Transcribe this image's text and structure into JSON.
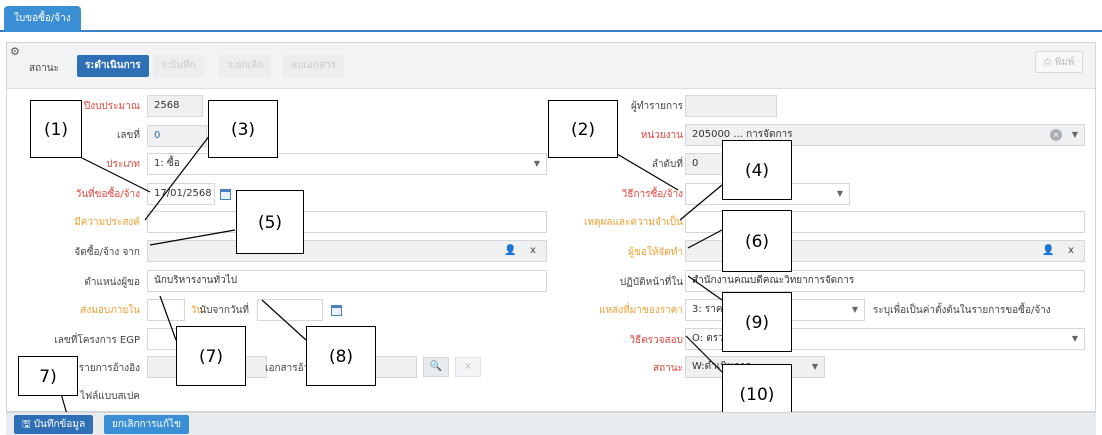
{
  "tab": {
    "label": "ใบขอซื้อ/จ้าง"
  },
  "toolbar": {
    "status_label": "สถานะ",
    "status_steps": [
      "ร:ดำเนินการ",
      "ร:บันทึก",
      "ร:ยกเลิก",
      "ลบเอกสาร"
    ],
    "print_label": "พิมพ์"
  },
  "form_left": {
    "fiscal_year_label": "ปีงบประมาณ",
    "fiscal_year_value": "2568",
    "doc_no_label": "เลขที่",
    "doc_no_value": "0",
    "type_label": "ประเภท",
    "type_value": "1: ซื้อ",
    "request_date_label": "วันที่ขอซื้อ/จ้าง",
    "request_date_value": "17/01/2568",
    "purpose_label": "มีความประสงค์",
    "vendor_label": "จัดซื้อ/จ้าง จาก",
    "position_label": "ตำแหน่งผู้ขอ",
    "position_value": "นักบริหารงานทั่วไป",
    "delivery_label": "ส่งมอบภายใน",
    "delivery_unit": "วัน",
    "delivery_from_label": "นับจากวันที่",
    "egp_label": "เลขที่โครงการ EGP",
    "ref_label": "รายการอ้างอิง",
    "ref_doc_label": "เอกสารอ้างอิง",
    "spec_label": "ไฟล์แบบสเปค"
  },
  "form_right": {
    "recorder_label": "ผู้ทำรายการ",
    "unit_label": "หน่วยงาน",
    "unit_value": "205000 ... การจัดการ",
    "seq_label": "ลำดับที่",
    "seq_value": "0",
    "method_label": "วิธีการซื้อ/จ้าง",
    "reason_label": "เหตุผลและความจำเป็น",
    "requester_label": "ผู้ขอให้จัดทำ",
    "workplace_label": "ปฏิบัติหน้าที่ใน",
    "workplace_value": "สำนักงานคณบดีคณะวิทยาการจัดการ",
    "budget_source_label": "แหล่งที่มาของราคา",
    "budget_source_value": "3: ราคา",
    "budget_note": "ระบุเพื่อเป็นค่าตั้งต้นในรายการขอซื้อ/จ้าง",
    "inspection_label": "วิธีตรวจสอบ",
    "inspection_value": "O: ตรวจส",
    "status_label": "สถานะ",
    "status_value": "W:ดำเนินการ"
  },
  "callouts": [
    "(1)",
    "(2)",
    "(3)",
    "(4)",
    "(5)",
    "(6)",
    "(7)",
    "(8)",
    "(9)",
    "(10)",
    "7)"
  ],
  "bottom": {
    "save_label": "บันทึกข้อมูล",
    "cancel_label": "ยกเลิกการแก้ไข"
  },
  "colors": {
    "primary": "#2f6fb6",
    "tab": "#3b8fd4",
    "required": "#e2453c",
    "optional": "#f0a030"
  }
}
